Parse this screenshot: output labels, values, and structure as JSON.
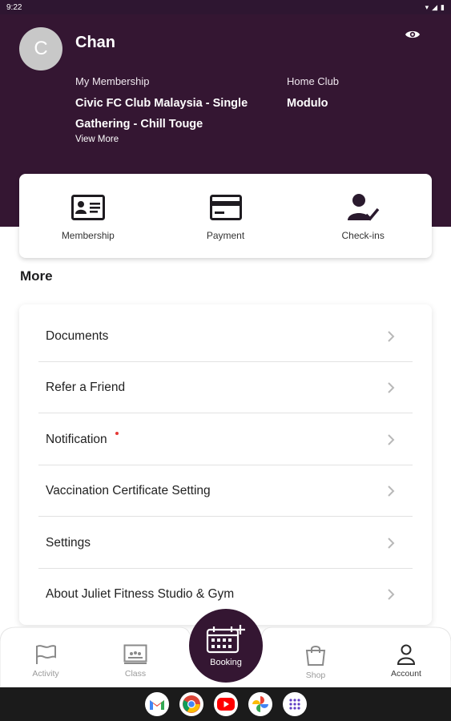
{
  "status_bar": {
    "time": "9:22"
  },
  "profile": {
    "initial": "C",
    "name": "Chan",
    "membership_label": "My Membership",
    "membership_value": "Civic FC Club Malaysia - Single Gathering - Chill Touge",
    "home_club_label": "Home Club",
    "home_club_value": "Modulo",
    "view_more": "View More"
  },
  "quick_actions": [
    {
      "label": "Membership",
      "icon": "id-card-icon"
    },
    {
      "label": "Payment",
      "icon": "credit-card-icon"
    },
    {
      "label": "Check-ins",
      "icon": "person-check-icon"
    }
  ],
  "more": {
    "title": "More",
    "items": [
      {
        "label": "Documents"
      },
      {
        "label": "Refer a Friend"
      },
      {
        "label": "Notification",
        "badge": "unread-dot"
      },
      {
        "label": "Vaccination Certificate Setting"
      },
      {
        "label": "Settings"
      },
      {
        "label": "About Juliet Fitness Studio & Gym"
      }
    ]
  },
  "bottom_nav": {
    "items": [
      {
        "label": "Activity",
        "icon": "flag-icon"
      },
      {
        "label": "Class",
        "icon": "class-board-icon"
      },
      {
        "label": "Booking",
        "icon": "calendar-add-icon"
      },
      {
        "label": "Shop",
        "icon": "shopping-bag-icon"
      },
      {
        "label": "Account",
        "icon": "person-icon",
        "active": true
      }
    ]
  },
  "colors": {
    "brand": "#341632",
    "notification_dot": "#e53935"
  },
  "taskbar_apps": [
    "gmail-icon",
    "chrome-icon",
    "youtube-icon",
    "photos-icon",
    "app-drawer-icon"
  ]
}
